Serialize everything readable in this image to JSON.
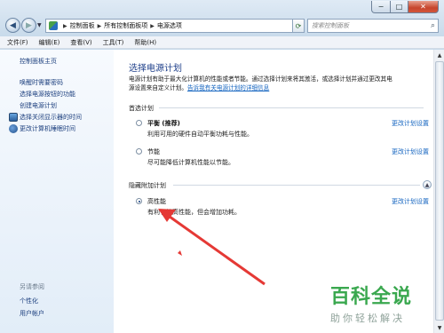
{
  "window": {
    "controls": [
      "−",
      "□",
      "✕"
    ]
  },
  "address": {
    "crumbs": [
      "控制面板",
      "所有控制面板项",
      "电源选项"
    ],
    "search_placeholder": "搜索控制面板"
  },
  "menu": [
    "文件(F)",
    "编辑(E)",
    "查看(V)",
    "工具(T)",
    "帮助(H)"
  ],
  "sidebar": {
    "home": "控制面板主页",
    "links": [
      {
        "label": "唤醒时需要密码",
        "icon": ""
      },
      {
        "label": "选择电源按钮的功能",
        "icon": ""
      },
      {
        "label": "创建电源计划",
        "icon": ""
      },
      {
        "label": "选择关闭显示器的时间",
        "icon": "monitor-icon"
      },
      {
        "label": "更改计算机睡眠时间",
        "icon": "moon-icon"
      }
    ],
    "see_also": "另请参阅",
    "bottom_links": [
      "个性化",
      "用户帐户"
    ]
  },
  "main": {
    "title": "选择电源计划",
    "desc_line1": "电源计划有助于最大化计算机的性能或者节能。通过选择计划来将其激活，或选择计划并通过更改其电",
    "desc_line2_prefix": "源设置来自定义计划。",
    "desc_link": "告诉我有关电源计划的详细信息",
    "preferred_label": "首选计划",
    "hidden_label": "隐藏附加计划",
    "plans": [
      {
        "name": "平衡 (推荐)",
        "desc": "利用可用的硬件自动平衡功耗与性能。",
        "link": "更改计划设置",
        "checked": false
      },
      {
        "name": "节能",
        "desc": "尽可能降低计算机性能以节能。",
        "link": "更改计划设置",
        "checked": false
      },
      {
        "name": "高性能",
        "desc": "有利于提高性能，但会增加功耗。",
        "link": "更改计划设置",
        "checked": true
      }
    ]
  },
  "watermark": {
    "big": "百科全说",
    "small": "助你轻松解决"
  },
  "colors": {
    "link": "#1565c0",
    "title": "#1e3f8a",
    "arrow": "#e53935",
    "watermark": "#3aa84f"
  }
}
